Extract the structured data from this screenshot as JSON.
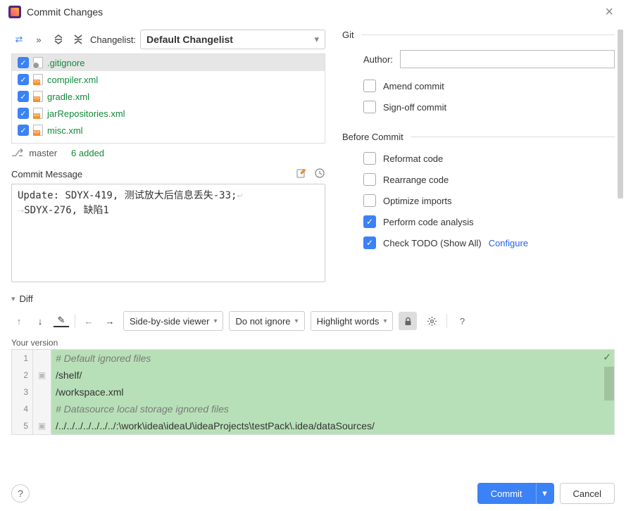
{
  "window": {
    "title": "Commit Changes"
  },
  "toolbar": {
    "changelist_label": "Changelist:",
    "changelist_value": "Default Changelist"
  },
  "files": [
    {
      "name": ".gitignore",
      "icon": "git",
      "checked": true,
      "selected": true
    },
    {
      "name": "compiler.xml",
      "icon": "xml",
      "checked": true,
      "selected": false
    },
    {
      "name": "gradle.xml",
      "icon": "xml",
      "checked": true,
      "selected": false
    },
    {
      "name": "jarRepositories.xml",
      "icon": "xml",
      "checked": true,
      "selected": false
    },
    {
      "name": "misc.xml",
      "icon": "xml",
      "checked": true,
      "selected": false
    }
  ],
  "branch": {
    "name": "master",
    "status": "6 added"
  },
  "commit_message": {
    "label": "Commit Message",
    "text": "Update: SDYX-419, 测试放大后信息丢失-33;\nSDYX-276, 缺陷1"
  },
  "git_section": {
    "label": "Git",
    "author_label": "Author:",
    "author_value": "",
    "amend_label": "Amend commit",
    "amend_checked": false,
    "signoff_label": "Sign-off commit",
    "signoff_checked": false
  },
  "before_commit": {
    "label": "Before Commit",
    "reformat": {
      "label": "Reformat code",
      "checked": false
    },
    "rearrange": {
      "label": "Rearrange code",
      "checked": false
    },
    "optimize": {
      "label": "Optimize imports",
      "checked": false
    },
    "analysis": {
      "label": "Perform code analysis",
      "checked": true
    },
    "todo": {
      "label": "Check TODO (Show All)",
      "checked": true,
      "configure": "Configure"
    }
  },
  "diff": {
    "label": "Diff",
    "viewer_mode": "Side-by-side viewer",
    "whitespace": "Do not ignore",
    "highlight": "Highlight words",
    "your_version": "Your version",
    "lines": [
      {
        "n": "1",
        "fold": "",
        "text": "# Default ignored files",
        "class": "comment"
      },
      {
        "n": "2",
        "fold": "▣",
        "text": "/shelf/",
        "class": "normal"
      },
      {
        "n": "3",
        "fold": "",
        "text": "/workspace.xml",
        "class": "normal"
      },
      {
        "n": "4",
        "fold": "",
        "text": "# Datasource local storage ignored files",
        "class": "comment"
      },
      {
        "n": "5",
        "fold": "▣",
        "text": "/../../../../../../../:\\work\\idea\\ideaU\\ideaProjects\\testPack\\.idea/dataSources/",
        "class": "normal"
      }
    ]
  },
  "buttons": {
    "commit": "Commit",
    "cancel": "Cancel"
  }
}
